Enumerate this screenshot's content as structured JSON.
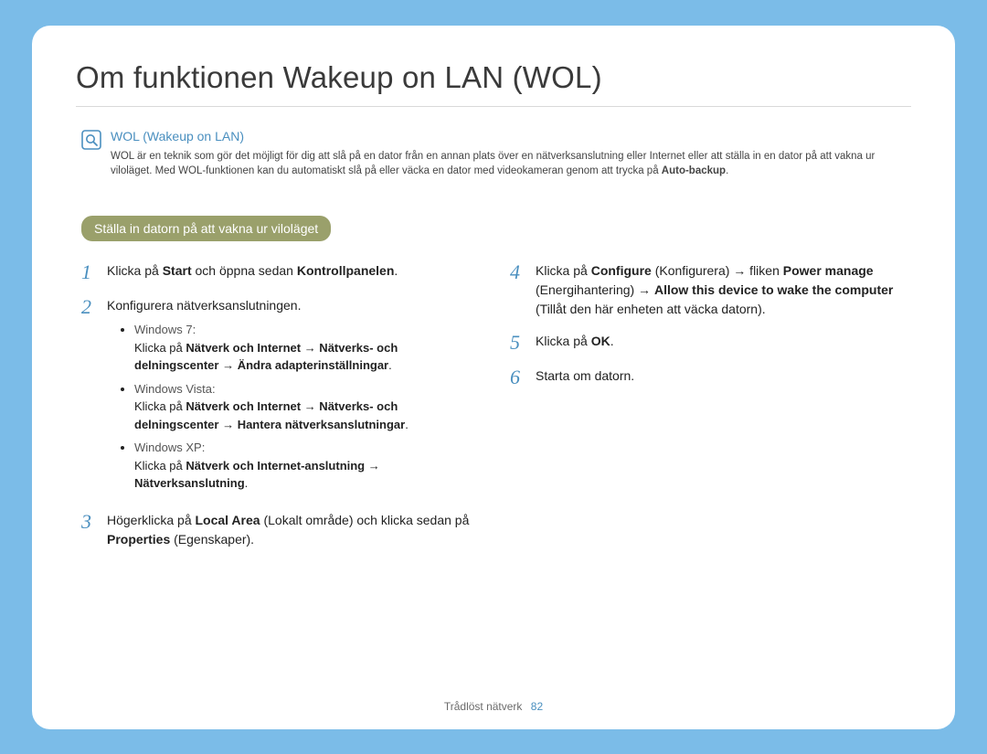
{
  "title": "Om funktionen Wakeup on LAN (WOL)",
  "callout": {
    "title": "WOL (Wakeup on LAN)",
    "text_pre": "WOL är en teknik som gör det möjligt för dig att slå på en dator från en annan plats över en nätverksanslutning eller Internet eller att ställa in en dator på att vakna ur viloläget. Med WOL-funktionen kan du automatiskt slå på eller väcka en dator med videokameran genom att trycka på ",
    "text_bold": "Auto-backup",
    "text_post": "."
  },
  "section_label": "Ställa in datorn på att vakna ur viloläget",
  "steps": {
    "s1": {
      "num": "1",
      "pre": "Klicka på ",
      "b1": "Start",
      "mid": " och öppna sedan ",
      "b2": "Kontrollpanelen",
      "post": "."
    },
    "s2": {
      "num": "2",
      "text": "Konfigurera nätverksanslutningen.",
      "bullets": {
        "b0": {
          "os": "Windows 7:",
          "pre": "Klicka på ",
          "bold": "Nätverk och Internet → Nätverks- och delningscenter → Ändra adapterinställningar",
          "post": "."
        },
        "b1": {
          "os": "Windows Vista:",
          "pre": "Klicka på ",
          "bold": "Nätverk och Internet → Nätverks- och delningscenter → Hantera nätverksanslutningar",
          "post": "."
        },
        "b2": {
          "os": "Windows XP:",
          "pre": "Klicka på ",
          "bold": "Nätverk och Internet-anslutning → Nätverksanslutning",
          "post": "."
        }
      }
    },
    "s3": {
      "num": "3",
      "pre": "Högerklicka på ",
      "b1": "Local Area",
      "mid1": " (Lokalt område) och klicka sedan på ",
      "b2": "Properties",
      "mid2": " (Egenskaper)."
    },
    "s4": {
      "num": "4",
      "pre": "Klicka på ",
      "b1": "Configure",
      "mid1": " (Konfigurera) → fliken ",
      "b2": "Power manage",
      "mid2": " (Energihantering) → ",
      "b3": "Allow this device to wake the computer",
      "mid3": " (Tillåt den här enheten att väcka datorn)."
    },
    "s5": {
      "num": "5",
      "pre": "Klicka på ",
      "b1": "OK",
      "post": "."
    },
    "s6": {
      "num": "6",
      "text": "Starta om datorn."
    }
  },
  "footer": {
    "label": "Trådlöst nätverk",
    "page": "82"
  }
}
